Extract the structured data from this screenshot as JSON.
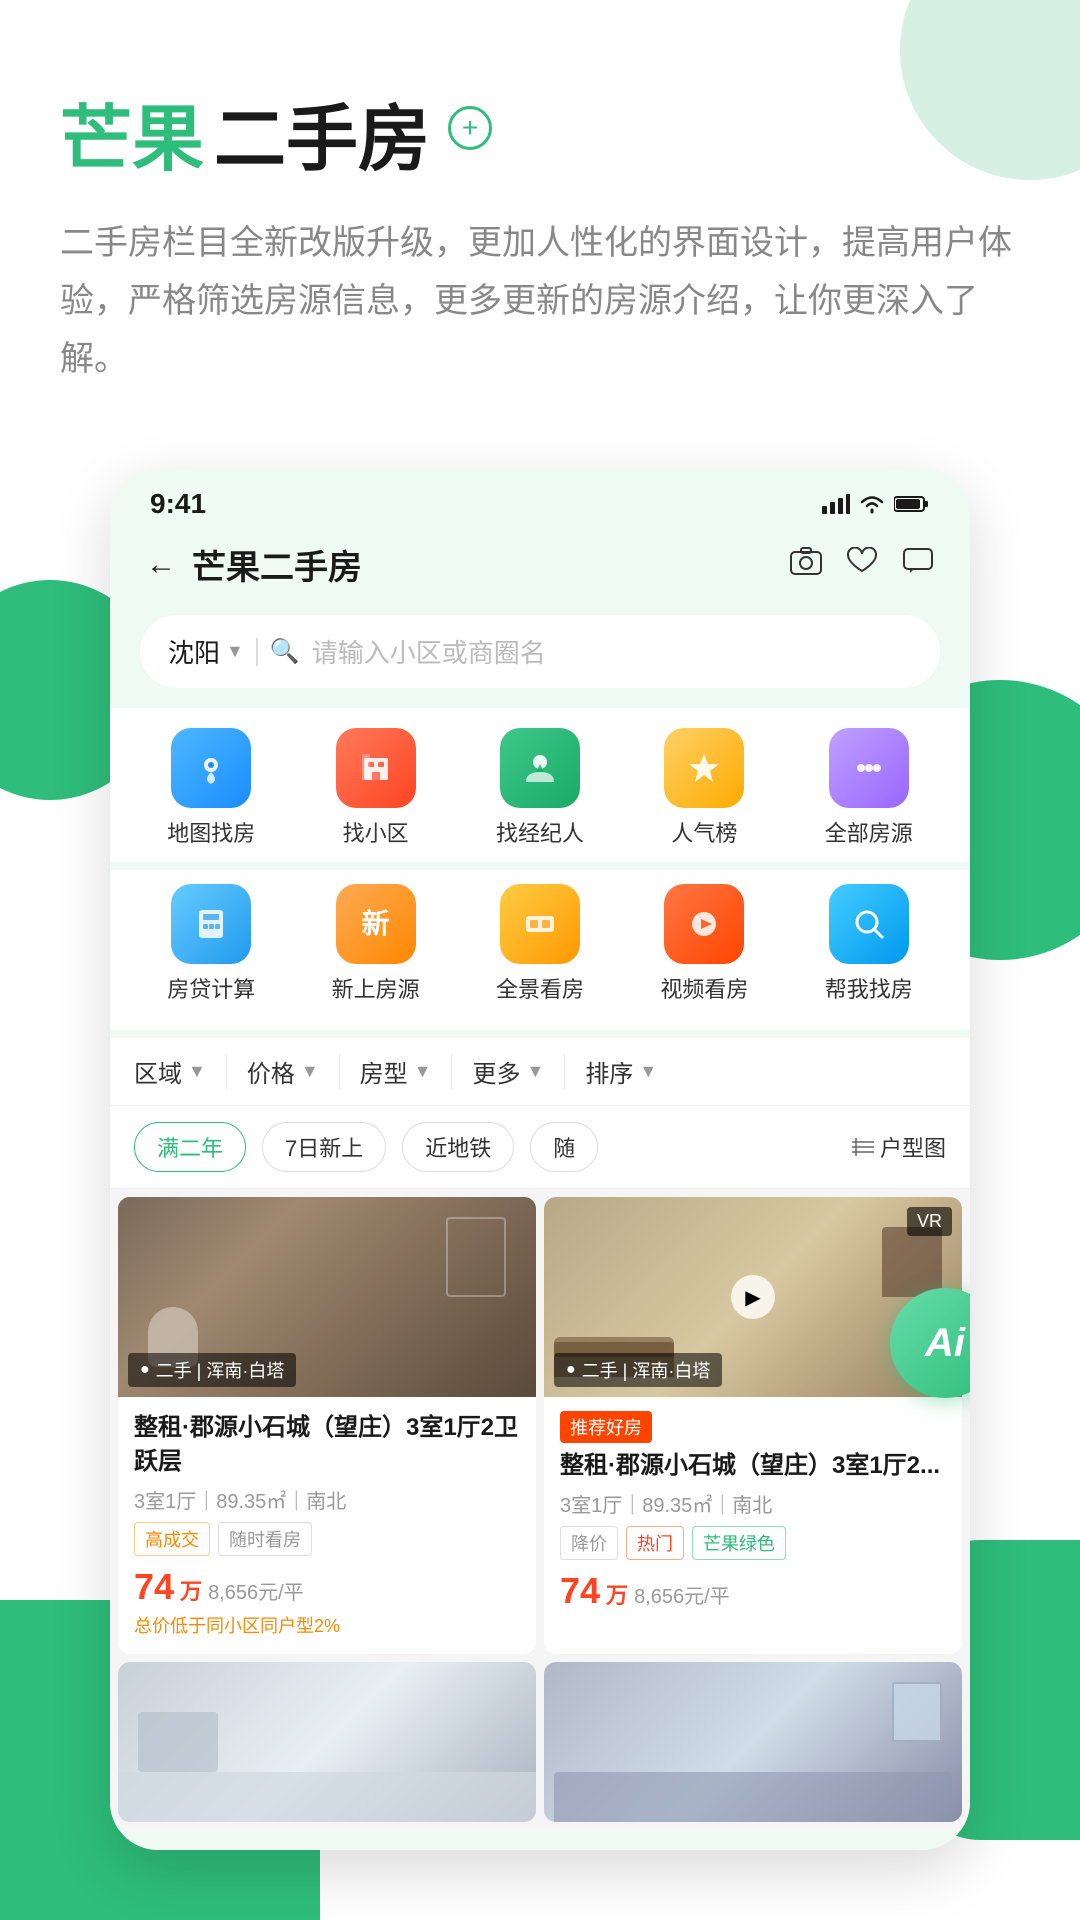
{
  "app": {
    "title_mango": "芒果",
    "title_rest": "二手房",
    "title_plus": "+",
    "description": "二手房栏目全新改版升级，更加人性化的界面设计，提高用户体验，严格筛选房源信息，更多更新的房源介绍，让你更深入了解。"
  },
  "status_bar": {
    "time": "9:41",
    "signal": "📶",
    "wifi": "WiFi",
    "battery": "🔋"
  },
  "nav": {
    "back": "←",
    "title": "芒果二手房",
    "icon_camera": "📷",
    "icon_heart": "♡",
    "icon_message": "💬"
  },
  "search": {
    "location": "沈阳",
    "placeholder": "请输入小区或商圈名"
  },
  "categories_row1": [
    {
      "id": "map",
      "label": "地图找房",
      "icon": "📍",
      "color": "cat-blue"
    },
    {
      "id": "community",
      "label": "找小区",
      "icon": "🏠",
      "color": "cat-red"
    },
    {
      "id": "broker",
      "label": "找经纪人",
      "icon": "👤",
      "color": "cat-green"
    },
    {
      "id": "popular",
      "label": "人气榜",
      "icon": "🏆",
      "color": "cat-orange"
    },
    {
      "id": "all",
      "label": "全部房源",
      "icon": "⋯",
      "color": "cat-purple"
    }
  ],
  "categories_row2": [
    {
      "id": "calc",
      "label": "房贷计算",
      "icon": "🔢",
      "color": "cat-blue2"
    },
    {
      "id": "new",
      "label": "新上房源",
      "icon": "新",
      "color": "cat-orange2"
    },
    {
      "id": "vr",
      "label": "全景看房",
      "icon": "🔷",
      "color": "cat-yellow"
    },
    {
      "id": "video",
      "label": "视频看房",
      "icon": "▶",
      "color": "cat-play"
    },
    {
      "id": "help",
      "label": "帮我找房",
      "icon": "🔍",
      "color": "cat-cyan"
    }
  ],
  "filters": [
    {
      "id": "area",
      "label": "区域"
    },
    {
      "id": "price",
      "label": "价格"
    },
    {
      "id": "type",
      "label": "房型"
    },
    {
      "id": "more",
      "label": "更多"
    },
    {
      "id": "sort",
      "label": "排序"
    }
  ],
  "tags": [
    {
      "id": "two-year",
      "label": "满二年",
      "active": true
    },
    {
      "id": "new7",
      "label": "7日新上",
      "active": false
    },
    {
      "id": "metro",
      "label": "近地铁",
      "active": false
    },
    {
      "id": "random",
      "label": "随",
      "active": false
    }
  ],
  "floor_plan_label": "户型图",
  "listings": [
    {
      "id": 1,
      "image_type": "bathroom",
      "badge": "二手 | 浑南·白塔",
      "recommend": false,
      "title": "整租·郡源小石城（望庄）3室1厅2卫 跃层",
      "meta": "3室1厅｜89.35㎡｜南北",
      "tags": [
        "高成交",
        "随时看房"
      ],
      "tag_styles": [
        "orange",
        "normal"
      ],
      "price": "74",
      "price_unit": "万",
      "price_per": "8,656元/平",
      "low_price_note": "总价低于同小区同户型2%"
    },
    {
      "id": 2,
      "image_type": "living",
      "badge": "二手 | 浑南·白塔",
      "has_vr": true,
      "has_play": true,
      "recommend": true,
      "recommend_label": "推荐好房",
      "title": "整租·郡源小石城（望庄）3室1厅2...",
      "meta": "3室1厅｜89.35㎡｜南北",
      "tags": [
        "降价",
        "热门",
        "芒果绿色"
      ],
      "tag_styles": [
        "normal",
        "red",
        "green"
      ],
      "price": "74",
      "price_unit": "万",
      "price_per": "8,656元/平",
      "low_price_note": ""
    },
    {
      "id": 3,
      "image_type": "kitchen",
      "badge": "",
      "recommend": false,
      "title": "",
      "meta": "",
      "tags": [],
      "price": "",
      "price_unit": "",
      "price_per": ""
    },
    {
      "id": 4,
      "image_type": "bedroom",
      "badge": "",
      "recommend": false,
      "title": "",
      "meta": "",
      "tags": [],
      "price": "",
      "price_unit": "",
      "price_per": ""
    }
  ],
  "ai_label": "Ai"
}
